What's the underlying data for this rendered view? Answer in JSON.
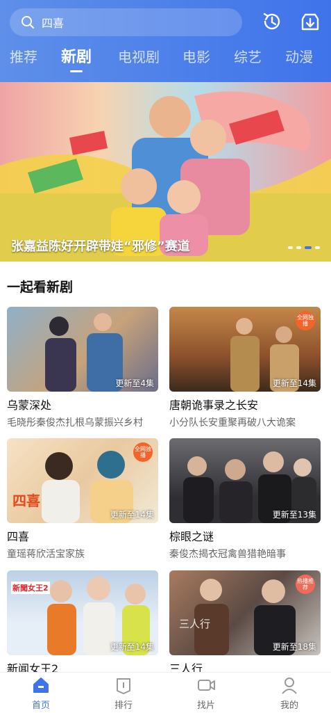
{
  "search": {
    "query": "四喜"
  },
  "tabs": [
    {
      "label": "推荐"
    },
    {
      "label": "新剧"
    },
    {
      "label": "电视剧"
    },
    {
      "label": "电影"
    },
    {
      "label": "综艺"
    },
    {
      "label": "动漫"
    }
  ],
  "banner": {
    "caption": "张嘉益陈好开辟带娃“邪修”赛道"
  },
  "section": {
    "title": "一起看新剧"
  },
  "cards": [
    {
      "title": "乌蒙深处",
      "sub": "毛晓彤秦俊杰扎根乌蒙振兴乡村",
      "update": "更新至4集"
    },
    {
      "title": "唐朝诡事录之长安",
      "sub": "小分队长安重聚再破八大诡案",
      "update": "更新至14集",
      "badge": "全网独播"
    },
    {
      "title": "四喜",
      "sub": "童瑶蒋欣活宝家族",
      "update": "更新至14集",
      "badge": "全网独播",
      "thumb_text": "四喜"
    },
    {
      "title": "棕眼之谜",
      "sub": "秦俊杰揭衣冠禽兽猎艳暗事",
      "update": "更新至13集"
    },
    {
      "title": "新闻女王2",
      "sub": "",
      "update": "更新至14集",
      "thumb_text": "新聞女王2"
    },
    {
      "title": "三人行",
      "sub": "",
      "update": "更新至18集",
      "badge": "热播推荐",
      "thumb_text": "三人行"
    }
  ],
  "nav": [
    {
      "label": "首页"
    },
    {
      "label": "排行"
    },
    {
      "label": "找片"
    },
    {
      "label": "我的"
    }
  ],
  "colors": {
    "accent": "#3f73ea",
    "header_start": "#5e8fe9"
  }
}
